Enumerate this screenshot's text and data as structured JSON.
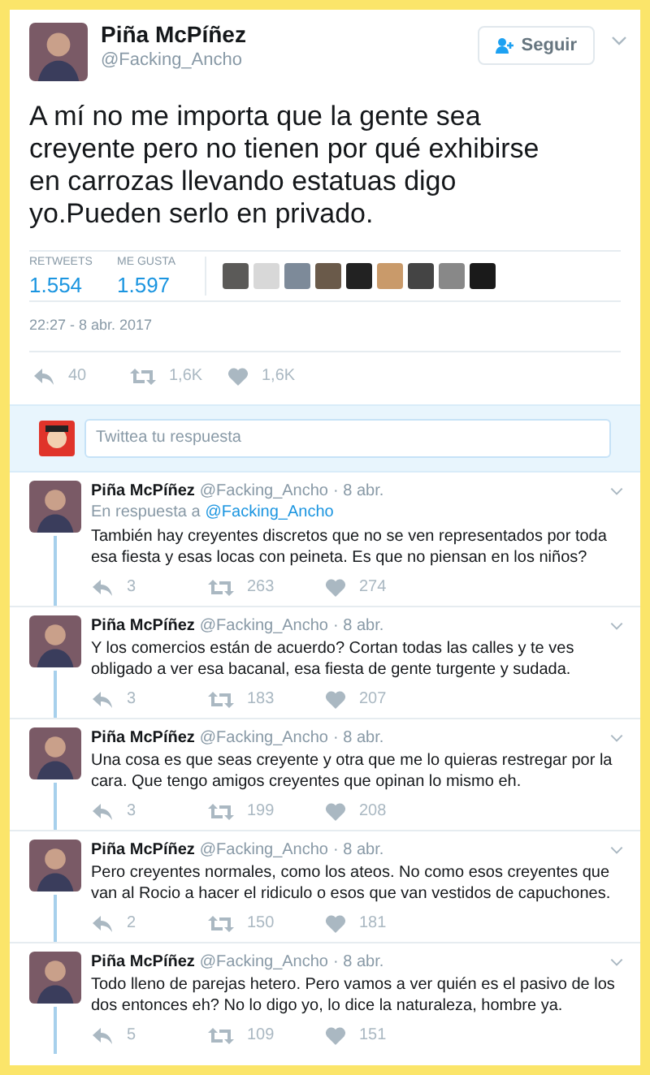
{
  "tweet": {
    "name": "Piña McPíñez",
    "handle": "@Facking_Ancho",
    "follow_label": "Seguir",
    "text": "A mí no me importa que la gente sea creyente pero no tienen por qué exhibirse en carrozas llevando estatuas digo yo.Pueden serlo en privado.",
    "stats": [
      {
        "label": "RETWEETS",
        "value": "1.554"
      },
      {
        "label": "ME GUSTA",
        "value": "1.597"
      }
    ],
    "timestamp": "22:27 - 8 abr. 2017",
    "actions": [
      {
        "kind": "reply",
        "count": "40"
      },
      {
        "kind": "retweet",
        "count": "1,6K"
      },
      {
        "kind": "like",
        "count": "1,6K"
      }
    ]
  },
  "compose": {
    "placeholder": "Twittea tu respuesta"
  },
  "replies": [
    {
      "name": "Piña McPíñez",
      "handle": "@Facking_Ancho",
      "date": "· 8 abr.",
      "in_reply_to": "En respuesta a",
      "in_reply_handle": "@Facking_Ancho",
      "text": "También hay creyentes discretos que no se ven representados por toda esa fiesta y esas locas con peineta. Es que no piensan en los niños?",
      "counts": [
        "3",
        "263",
        "274"
      ]
    },
    {
      "name": "Piña McPíñez",
      "handle": "@Facking_Ancho",
      "date": "· 8 abr.",
      "text": "Y los comercios están de acuerdo? Cortan todas las calles y te ves obligado a ver esa bacanal, esa fiesta de gente turgente y sudada.",
      "counts": [
        "3",
        "183",
        "207"
      ]
    },
    {
      "name": "Piña McPíñez",
      "handle": "@Facking_Ancho",
      "date": "· 8 abr.",
      "text": "Una cosa es que seas creyente y otra que me lo quieras restregar por la cara. Que tengo amigos creyentes que opinan lo mismo eh.",
      "counts": [
        "3",
        "199",
        "208"
      ]
    },
    {
      "name": "Piña McPíñez",
      "handle": "@Facking_Ancho",
      "date": "· 8 abr.",
      "text": "Pero creyentes normales, como los ateos. No como esos creyentes que van al Rocio a hacer el ridiculo o esos que van vestidos de capuchones.",
      "counts": [
        "2",
        "150",
        "181"
      ]
    },
    {
      "name": "Piña McPíñez",
      "handle": "@Facking_Ancho",
      "date": "· 8 abr.",
      "text": "Todo lleno de parejas hetero. Pero vamos a ver quién es el pasivo de los dos entonces eh? No lo digo yo, lo dice la naturaleza, hombre ya.",
      "counts": [
        "5",
        "109",
        "151"
      ]
    }
  ]
}
